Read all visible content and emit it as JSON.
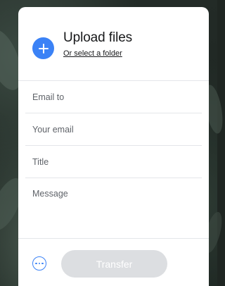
{
  "upload": {
    "title": "Upload files",
    "folder_link": "Or select a folder",
    "add_icon": "plus-icon"
  },
  "form": {
    "email_to": "Email to",
    "your_email": "Your email",
    "title": "Title",
    "message": "Message"
  },
  "footer": {
    "more_icon": "ellipsis-icon",
    "transfer_label": "Transfer",
    "transfer_enabled": false
  },
  "colors": {
    "accent": "#3b82f6",
    "button_disabled": "#dcdee1",
    "text": "#17181a",
    "placeholder": "#5f6369"
  }
}
